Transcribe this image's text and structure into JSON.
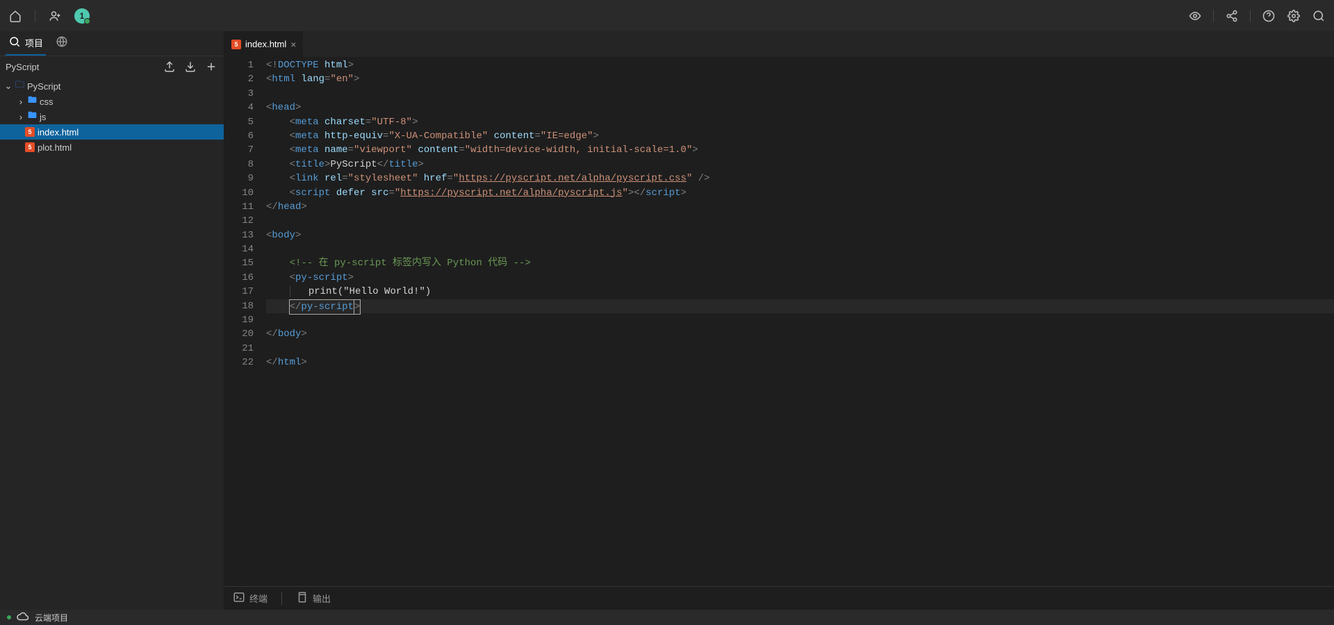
{
  "titlebar": {
    "avatar_label": "1"
  },
  "sidebar": {
    "tab_project": "项目",
    "project_name": "PyScript",
    "tree": {
      "root": "PyScript",
      "css": "css",
      "js": "js",
      "index": "index.html",
      "plot": "plot.html"
    }
  },
  "tabs": {
    "active": "index.html"
  },
  "code": {
    "lines": 22,
    "l1": "<!DOCTYPE html>",
    "l2": "<html lang=\"en\">",
    "l4": "<head>",
    "l5_charset": "UTF-8",
    "l6_equiv": "X-UA-Compatible",
    "l6_content": "IE=edge",
    "l7_name": "viewport",
    "l7_content": "width=device-width, initial-scale=1.0",
    "l8_title": "PyScript",
    "l9_rel": "stylesheet",
    "l9_href": "https://pyscript.net/alpha/pyscript.css",
    "l10_src": "https://pyscript.net/alpha/pyscript.js",
    "l15_comment": "<!-- 在 py-script 标签内写入 Python 代码 -->",
    "l17_print": "print(\"Hello World!\")"
  },
  "panel": {
    "terminal": "终端",
    "output": "输出"
  },
  "status": {
    "cloud": "云端项目"
  }
}
